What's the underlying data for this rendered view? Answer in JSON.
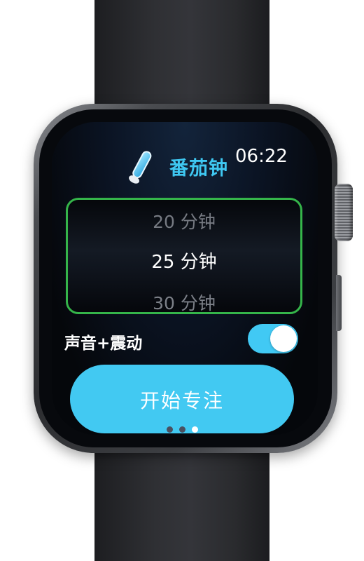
{
  "app": {
    "title": "番茄钟",
    "icon": "pencil-icon"
  },
  "status_bar": {
    "time": "06:22"
  },
  "duration_picker": {
    "options": [
      "20 分钟",
      "25 分钟",
      "30 分钟"
    ],
    "selected": "25 分钟",
    "accent_color": "#35b54a"
  },
  "alert_setting": {
    "label": "声音+震动",
    "enabled": true,
    "color": "#41c9f4"
  },
  "start_button": {
    "label": "开始专注",
    "color": "#42c9f2"
  },
  "page_indicator": {
    "count": 3,
    "active_index": 2
  }
}
